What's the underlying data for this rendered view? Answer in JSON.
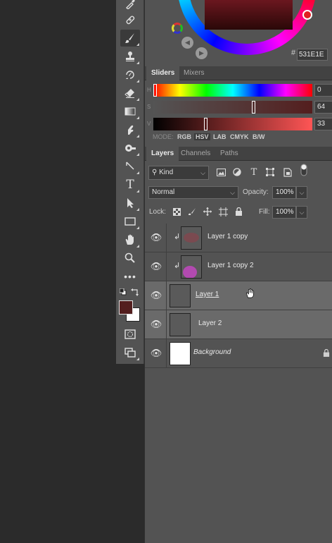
{
  "colors": {
    "foreground": "#531E1E",
    "background": "#FFFFFF",
    "ui_panel": "#535353",
    "canvas": "#2B2B2B"
  },
  "toolbar": {
    "tools": [
      {
        "name": "eyedropper-icon",
        "glyph": "✎"
      },
      {
        "name": "healing-brush-icon",
        "glyph": "✚"
      },
      {
        "name": "brush-icon",
        "glyph": "🖌"
      },
      {
        "name": "clone-stamp-icon",
        "glyph": "⊥"
      },
      {
        "name": "history-brush-icon",
        "glyph": "↺"
      },
      {
        "name": "eraser-icon",
        "glyph": "◆"
      },
      {
        "name": "gradient-icon",
        "glyph": "▭"
      },
      {
        "name": "smudge-icon",
        "glyph": "☝"
      },
      {
        "name": "dodge-icon",
        "glyph": "◉"
      },
      {
        "name": "pen-icon",
        "glyph": "↘"
      },
      {
        "name": "type-icon",
        "glyph": "T"
      },
      {
        "name": "path-selection-icon",
        "glyph": "➤"
      },
      {
        "name": "rectangle-icon",
        "glyph": "▭"
      },
      {
        "name": "hand-icon",
        "glyph": "✋"
      },
      {
        "name": "zoom-icon",
        "glyph": "⚲"
      },
      {
        "name": "more-tools-icon",
        "glyph": "•••"
      }
    ]
  },
  "color_panel": {
    "hex_label": "#",
    "hex_value": "531E1E"
  },
  "sliders_panel": {
    "tabs": [
      "Sliders",
      "Mixers"
    ],
    "channels": [
      {
        "letter": "H",
        "value": "0",
        "level": 0.0
      },
      {
        "letter": "S",
        "value": "64",
        "level": 0.64
      },
      {
        "letter": "V",
        "value": "33",
        "level": 0.33
      }
    ],
    "mode_label": "MODE:",
    "modes": [
      "RGB",
      "HSV",
      "LAB",
      "CMYK",
      "B/W"
    ],
    "selected_mode": "HSV"
  },
  "layers_panel": {
    "tabs": [
      "Layers",
      "Channels",
      "Paths"
    ],
    "filter_kind": "Kind",
    "blend_mode": "Normal",
    "opacity_label": "Opacity:",
    "opacity_value": "100%",
    "lock_label": "Lock:",
    "fill_label": "Fill:",
    "fill_value": "100%",
    "layers": [
      {
        "name": "Layer 1 copy",
        "clipped": true,
        "selected": false
      },
      {
        "name": "Layer 1 copy 2",
        "clipped": true,
        "selected": false
      },
      {
        "name": "Layer 1",
        "clipped": false,
        "selected": true
      },
      {
        "name": "Layer 2",
        "clipped": false,
        "selected": true
      },
      {
        "name": "Background",
        "clipped": false,
        "selected": false,
        "locked": true
      }
    ]
  }
}
